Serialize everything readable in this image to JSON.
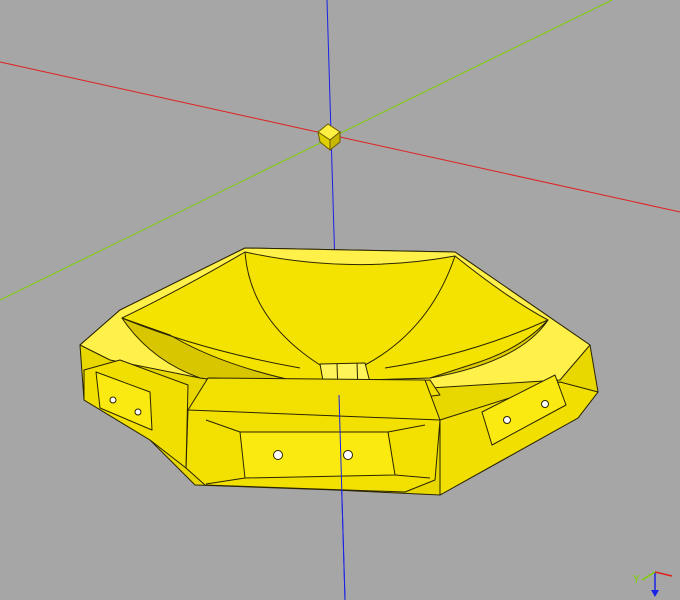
{
  "viewport": {
    "background": "#a6a6a6",
    "model_color": "#f5e400",
    "model_shadow": "#c9b800",
    "edge_color": "#2a2400"
  },
  "axes": {
    "x_color": "#e02020",
    "y_color": "#7dd000",
    "z_color": "#1a22e6"
  },
  "triad": {
    "y_label": "Y"
  },
  "icons": [
    "origin-marker-icon",
    "orientation-triad-icon"
  ]
}
